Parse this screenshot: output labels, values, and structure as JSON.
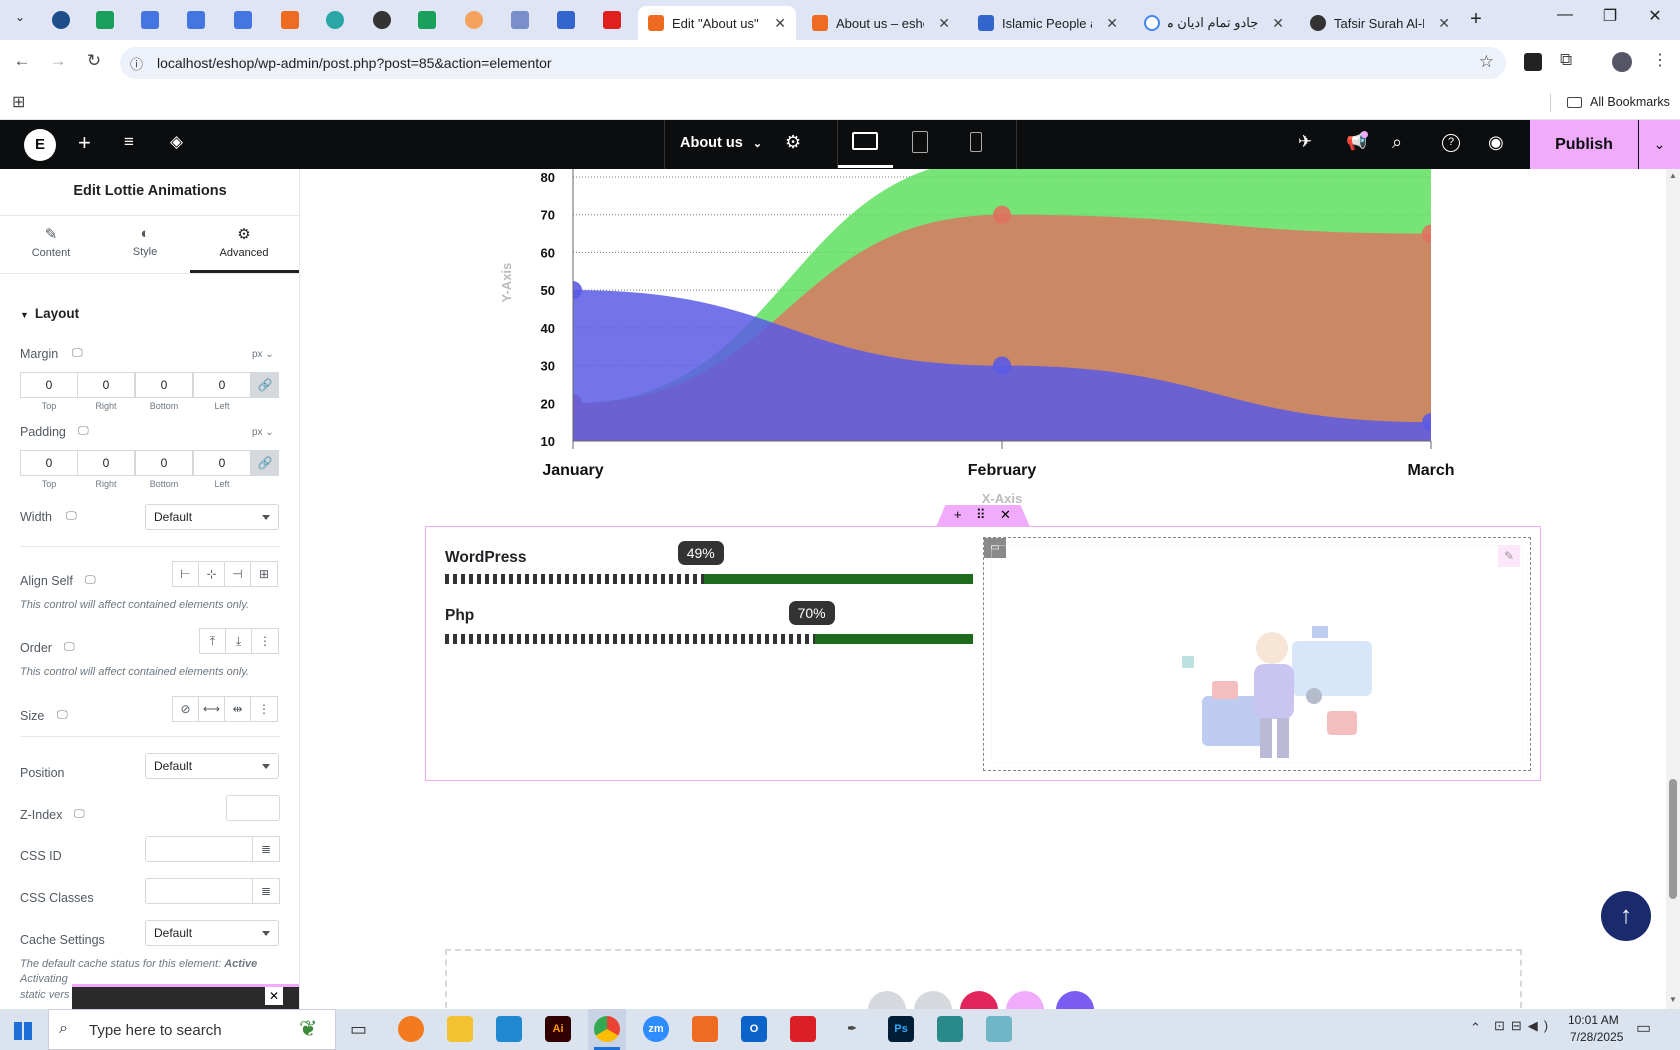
{
  "browser": {
    "tabs": [
      {
        "title": "Edit \"About us\" w",
        "active": true
      },
      {
        "title": "About us – eshop",
        "active": false
      },
      {
        "title": "Islamic People an",
        "active": false
      },
      {
        "title": "جادو تمام ادیان مد",
        "active": false
      },
      {
        "title": "Tafsir Surah Al-Ba",
        "active": false
      }
    ],
    "new_tab": "+",
    "minimize": "—",
    "restore": "❐",
    "close": "✕",
    "url": "localhost/eshop/wp-admin/post.php?post=85&action=elementor",
    "bookmarks_label": "All Bookmarks"
  },
  "editor": {
    "page_title": "About us",
    "publish_label": "Publish"
  },
  "panel": {
    "title": "Edit Lottie Animations",
    "tabs": [
      {
        "label": "Content",
        "icon": "pencil-icon"
      },
      {
        "label": "Style",
        "icon": "half-circle-icon"
      },
      {
        "label": "Advanced",
        "icon": "gear-icon"
      }
    ],
    "section": "Layout",
    "margin": {
      "label": "Margin",
      "unit": "px",
      "values": [
        "0",
        "0",
        "0",
        "0"
      ]
    },
    "padding": {
      "label": "Padding",
      "unit": "px",
      "values": [
        "0",
        "0",
        "0",
        "0"
      ]
    },
    "dim_labels": [
      "Top",
      "Right",
      "Bottom",
      "Left"
    ],
    "width": {
      "label": "Width",
      "value": "Default"
    },
    "align_self": {
      "label": "Align Self",
      "note": "This control will affect contained elements only."
    },
    "order": {
      "label": "Order",
      "note": "This control will affect contained elements only."
    },
    "size": {
      "label": "Size"
    },
    "position": {
      "label": "Position",
      "value": "Default"
    },
    "z_index": {
      "label": "Z-Index"
    },
    "css_id": {
      "label": "CSS ID"
    },
    "css_classes": {
      "label": "CSS Classes"
    },
    "cache": {
      "label": "Cache Settings",
      "value": "Default"
    },
    "cache_note_prefix": "The default cache status for this element: ",
    "cache_note_status": "Active",
    "cache_note_line2": "Activating",
    "cache_note_line3": "static vers"
  },
  "chart_data": {
    "type": "area",
    "categories": [
      "January",
      "February",
      "March"
    ],
    "yticks": [
      10,
      20,
      30,
      40,
      50,
      60,
      70,
      80
    ],
    "ylim": [
      10,
      80
    ],
    "ylabel": "Y-Axis",
    "xlabel": "X-Axis",
    "series": [
      {
        "color": "#5b5be6",
        "values": [
          50,
          30,
          15
        ]
      },
      {
        "color": "#e07060",
        "values": [
          20,
          70,
          65
        ]
      },
      {
        "color": "#55dd55",
        "values": [
          20,
          85,
          95
        ]
      }
    ]
  },
  "progress": [
    {
      "label": "WordPress",
      "percent": 49,
      "text": "49%"
    },
    {
      "label": "Php",
      "percent": 70,
      "text": "70%"
    }
  ],
  "taskbar": {
    "search_placeholder": "Type here to search",
    "time": "10:01 AM",
    "date": "7/28/2025"
  },
  "colors": {
    "elementor_bar": "#0c0d0e",
    "publish": "#f0abfc",
    "progress_fill": "#1e6b1e",
    "back_to_top": "#1a2a6c"
  }
}
